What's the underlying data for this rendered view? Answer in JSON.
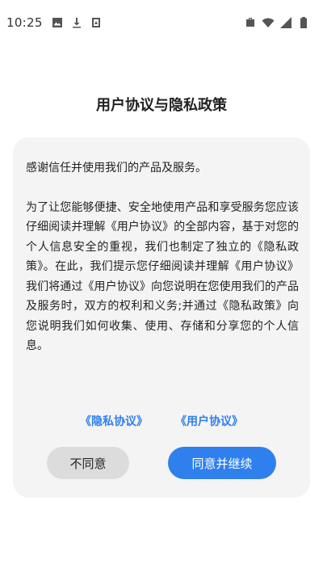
{
  "status_bar": {
    "time": "10:25",
    "left_icons": [
      "image-icon",
      "download-icon",
      "app-notification-icon"
    ],
    "right_icons": [
      "briefcase-icon",
      "wifi-icon",
      "signal-icon",
      "battery-icon"
    ]
  },
  "page": {
    "title": "用户协议与隐私政策"
  },
  "dialog": {
    "intro": "感谢信任并使用我们的产品及服务。",
    "body": "为了让您能够便捷、安全地使用产品和享受服务您应该仔细阅读并理解《用户协议》的全部内容，基于对您的个人信息安全的重视，我们也制定了独立的《隐私政策》。在此，我们提示您仔细阅读并理解《用户协议》我们将通过《用户协议》向您说明在您使用我们的产品及服务时，双方的权利和义务;并通过《隐私政策》向您说明我们如何收集、使用、存储和分享您的个人信息。",
    "privacy_link": "《隐私协议》",
    "user_agreement_link": "《用户协议》",
    "disagree_label": "不同意",
    "agree_label": "同意并继续"
  },
  "colors": {
    "accent": "#2f80ed",
    "card_bg": "#f4f4f4",
    "secondary_button_bg": "#dcdcdc"
  }
}
